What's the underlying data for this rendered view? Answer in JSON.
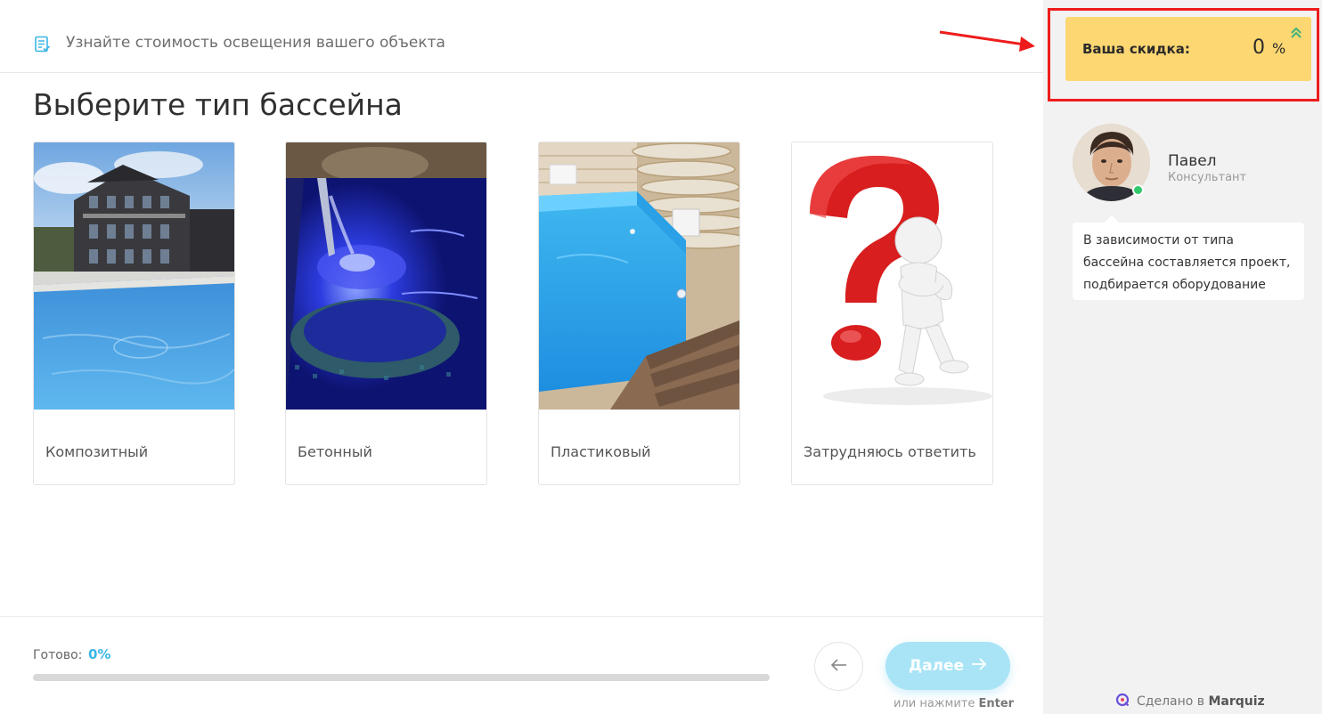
{
  "header": {
    "title": "Узнайте стоимость освещения вашего объекта",
    "icon": "checklist-icon"
  },
  "question": {
    "title": "Выберите тип бассейна"
  },
  "options": [
    {
      "label": "Композитный",
      "image": "composite-pool-photo"
    },
    {
      "label": "Бетонный",
      "image": "concrete-pool-photo"
    },
    {
      "label": "Пластиковый",
      "image": "plastic-pool-photo"
    },
    {
      "label": "Затрудняюсь ответить",
      "image": "question-mark-figure-image"
    }
  ],
  "footer": {
    "ready_label": "Готово:",
    "ready_value": "0%",
    "progress": 0,
    "back_icon": "arrow-left-icon",
    "next_label": "Далее",
    "next_icon": "arrow-right-icon",
    "hint_prefix": "или нажмите",
    "hint_key": "Enter"
  },
  "sidebar": {
    "discount_label": "Ваша скидка:",
    "discount_value": "0",
    "discount_unit": "%",
    "consultant_name": "Павел",
    "consultant_role": "Консультант",
    "message": "В зависимости от типа бассейна составляется проект, подбирается оборудование",
    "made_by_prefix": "Сделано в",
    "made_by_brand": "Marquiz"
  },
  "colors": {
    "accent": "#3cb6e6",
    "next_button": "#a9e4f6",
    "discount_bg": "#fcd772",
    "highlight": "#ee1c1c",
    "online": "#32c96a"
  }
}
